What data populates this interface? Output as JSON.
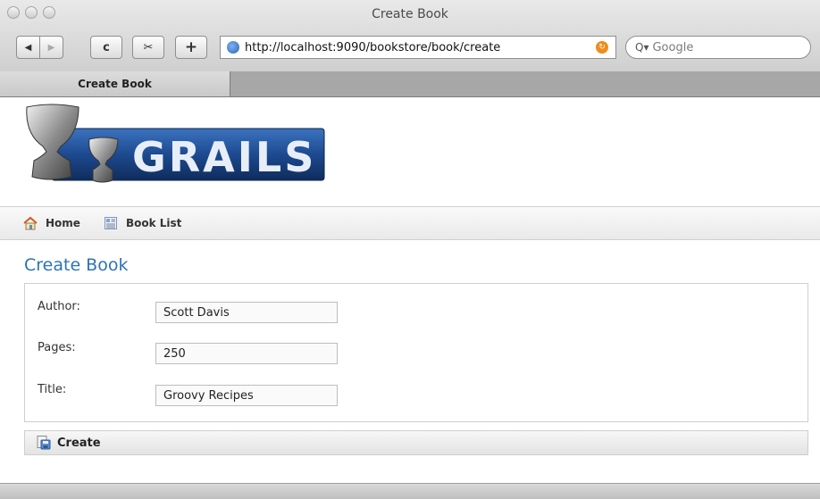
{
  "window": {
    "title": "Create Book"
  },
  "toolbar": {
    "back_glyph": "◀",
    "forward_glyph": "▶",
    "reload_glyph": "c",
    "snip_glyph": "✂",
    "add_glyph": "+",
    "url": "http://localhost:9090/bookstore/book/create",
    "search_placeholder": "Google"
  },
  "tab": {
    "label": "Create Book"
  },
  "nav": {
    "items": [
      {
        "label": "Home",
        "icon": "house-icon"
      },
      {
        "label": "Book List",
        "icon": "list-icon"
      }
    ]
  },
  "page": {
    "heading": "Create Book"
  },
  "form": {
    "fields": [
      {
        "label": "Author:",
        "value": "Scott Davis"
      },
      {
        "label": "Pages:",
        "value": "250"
      },
      {
        "label": "Title:",
        "value": "Groovy Recipes"
      }
    ],
    "create_label": "Create"
  },
  "colors": {
    "heading": "#2d74b5",
    "brand_blue": "#1f4f96"
  }
}
